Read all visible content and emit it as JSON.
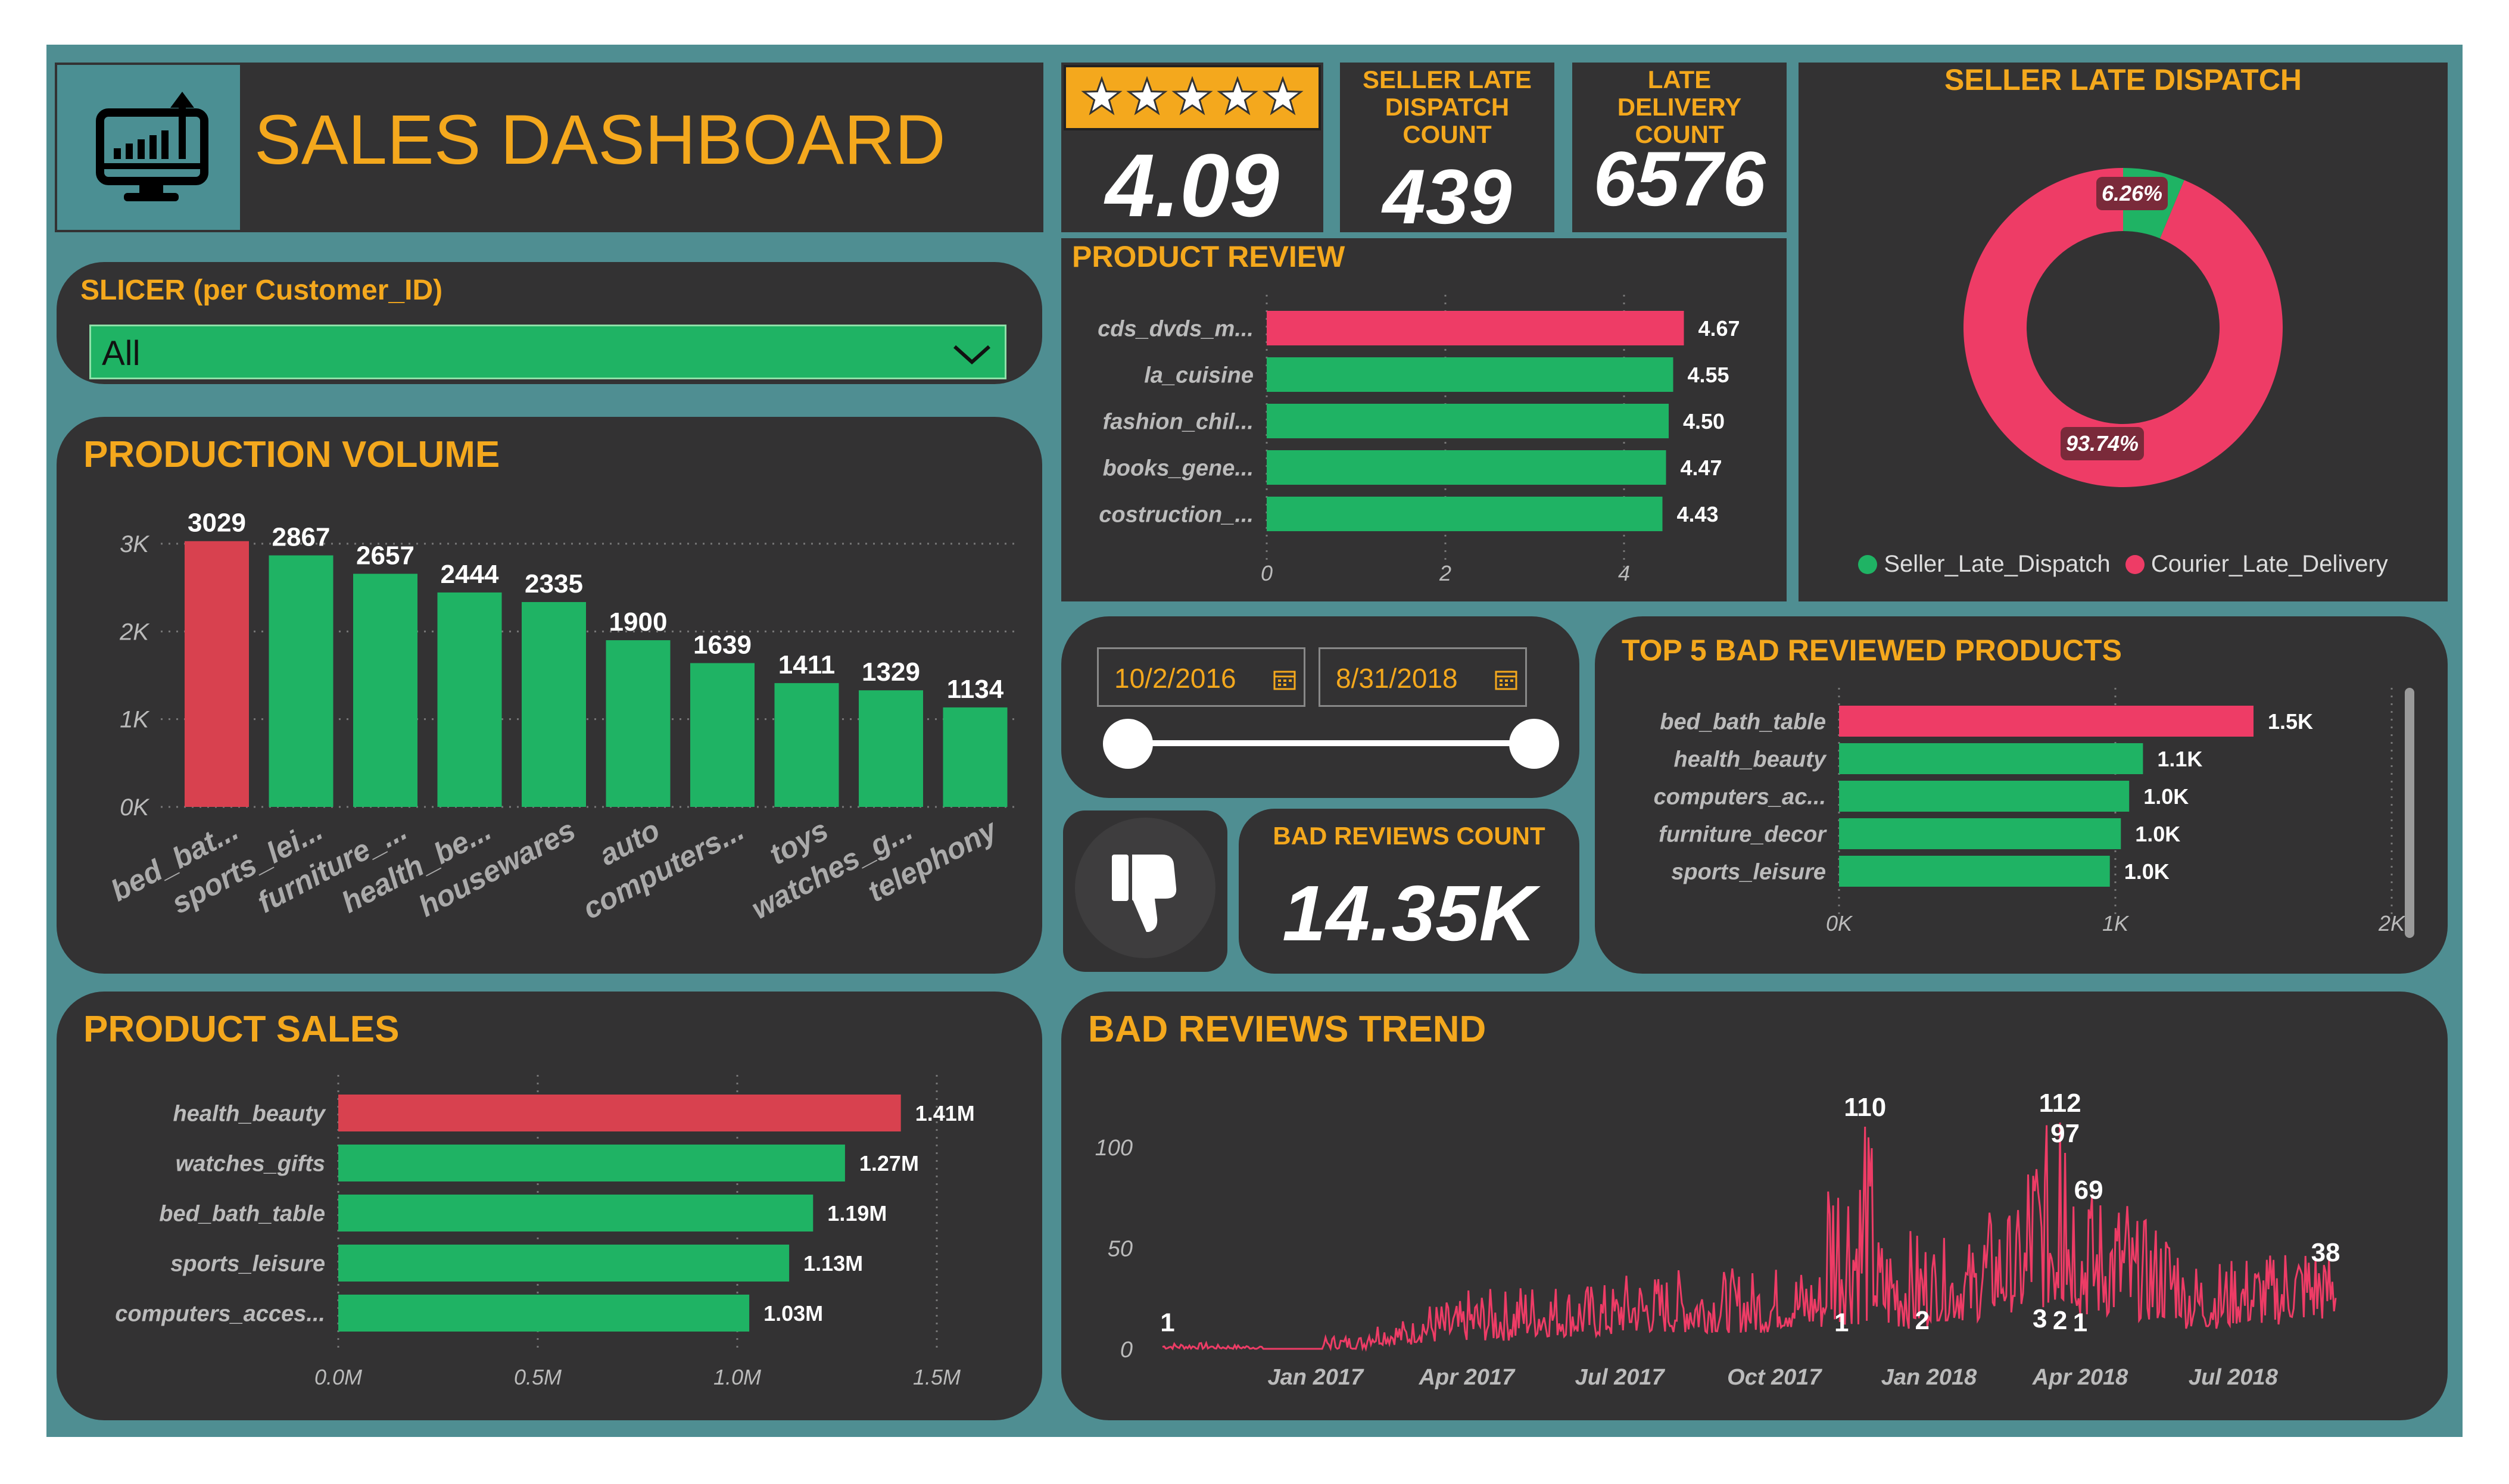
{
  "header": {
    "title": "SALES DASHBOARD",
    "icon": "monitor-chart-icon"
  },
  "kpis": {
    "rating": {
      "value": "4.09",
      "stars": 5
    },
    "seller_late_dispatch_count": {
      "label": "SELLER LATE DISPATCH COUNT",
      "value": "439"
    },
    "late_delivery_count": {
      "label": "LATE DELIVERY COUNT",
      "value": "6576"
    },
    "bad_reviews_count": {
      "label": "BAD REVIEWS COUNT",
      "value": "14.35K"
    }
  },
  "slicer": {
    "title": "SLICER (per Customer_ID)",
    "selected": "All"
  },
  "date_range": {
    "start": "10/2/2016",
    "end": "8/31/2018"
  },
  "colors": {
    "accent": "#f4a81d",
    "green": "#1fb364",
    "red": "#d8414f",
    "pink": "#ee3c66",
    "panel": "#333233",
    "frame": "#4f8e92"
  },
  "chart_data": [
    {
      "id": "production_volume",
      "type": "bar",
      "title": "PRODUCTION VOLUME",
      "categories": [
        "bed_bat...",
        "sports_lei...",
        "furniture_...",
        "health_be...",
        "housewares",
        "auto",
        "computers...",
        "toys",
        "watches_g...",
        "telephony"
      ],
      "values": [
        3029,
        2867,
        2657,
        2444,
        2335,
        1900,
        1639,
        1411,
        1329,
        1134
      ],
      "yticks": [
        "0K",
        "1K",
        "2K",
        "3K"
      ],
      "ylim": [
        0,
        3000
      ],
      "highlight_index": 0
    },
    {
      "id": "product_review",
      "type": "bar",
      "orientation": "horizontal",
      "title": "PRODUCT REVIEW",
      "categories": [
        "cds_dvds_m...",
        "la_cuisine",
        "fashion_chil...",
        "books_gene...",
        "costruction_..."
      ],
      "values": [
        4.67,
        4.55,
        4.5,
        4.47,
        4.43
      ],
      "labels": [
        "4.67",
        "4.55",
        "4.50",
        "4.47",
        "4.43"
      ],
      "xticks": [
        "0",
        "2",
        "4"
      ],
      "xlim": [
        0,
        5.4
      ],
      "highlight_index": 0
    },
    {
      "id": "seller_late_dispatch",
      "type": "pie",
      "title": "SELLER LATE DISPATCH",
      "slices": [
        {
          "name": "Seller_Late_Dispatch",
          "value": 6.26,
          "label": "6.26%",
          "color": "#1fb364"
        },
        {
          "name": "Courier_Late_Delivery",
          "value": 93.74,
          "label": "93.74%",
          "color": "#ee3c66"
        }
      ]
    },
    {
      "id": "top5_bad_reviewed",
      "type": "bar",
      "orientation": "horizontal",
      "title": "TOP 5 BAD REVIEWED PRODUCTS",
      "categories": [
        "bed_bath_table",
        "health_beauty",
        "computers_ac...",
        "furniture_decor",
        "sports_leisure"
      ],
      "values": [
        1.5,
        1.1,
        1.05,
        1.02,
        0.98
      ],
      "labels": [
        "1.5K",
        "1.1K",
        "1.0K",
        "1.0K",
        "1.0K"
      ],
      "xticks": [
        "0K",
        "1K",
        "2K"
      ],
      "xlim": [
        0,
        2
      ],
      "unit": "K",
      "highlight_index": 0
    },
    {
      "id": "product_sales",
      "type": "bar",
      "orientation": "horizontal",
      "title": "PRODUCT SALES",
      "categories": [
        "health_beauty",
        "watches_gifts",
        "bed_bath_table",
        "sports_leisure",
        "computers_acces..."
      ],
      "values": [
        1.41,
        1.27,
        1.19,
        1.13,
        1.03
      ],
      "labels": [
        "1.41M",
        "1.27M",
        "1.19M",
        "1.13M",
        "1.03M"
      ],
      "xticks": [
        "0.0M",
        "0.5M",
        "1.0M",
        "1.5M"
      ],
      "xlim": [
        0,
        1.5
      ],
      "unit": "M",
      "highlight_index": 0
    },
    {
      "id": "bad_reviews_trend",
      "type": "line",
      "title": "BAD REVIEWS TREND",
      "x_start": "2016-10-02",
      "x_end": "2018-08-31",
      "xticks": [
        "Jan 2017",
        "Apr 2017",
        "Jul 2017",
        "Oct 2017",
        "Jan 2018",
        "Apr 2018",
        "Jul 2018"
      ],
      "yticks": [
        "0",
        "50",
        "100"
      ],
      "ylim": [
        0,
        115
      ],
      "annotations": [
        {
          "label": "1",
          "date": "2016-10-05",
          "value": 1
        },
        {
          "label": "110",
          "date": "2017-11-24",
          "value": 110
        },
        {
          "label": "1",
          "date": "2017-11-10",
          "value": 1
        },
        {
          "label": "2",
          "date": "2017-12-28",
          "value": 2
        },
        {
          "label": "112",
          "date": "2018-03-20",
          "value": 112
        },
        {
          "label": "97",
          "date": "2018-03-23",
          "value": 97
        },
        {
          "label": "69",
          "date": "2018-04-06",
          "value": 69
        },
        {
          "label": "3",
          "date": "2018-03-08",
          "value": 3
        },
        {
          "label": "2",
          "date": "2018-03-20",
          "value": 2
        },
        {
          "label": "1",
          "date": "2018-04-01",
          "value": 1
        },
        {
          "label": "38",
          "date": "2018-08-25",
          "value": 38
        }
      ],
      "monthly_profile": [
        {
          "month": "2016-10",
          "low": 0,
          "high": 3
        },
        {
          "month": "2016-11",
          "low": 0,
          "high": 2
        },
        {
          "month": "2016-12",
          "low": 0,
          "high": 1
        },
        {
          "month": "2017-01",
          "low": 0,
          "high": 7
        },
        {
          "month": "2017-02",
          "low": 2,
          "high": 15
        },
        {
          "month": "2017-03",
          "low": 3,
          "high": 24
        },
        {
          "month": "2017-04",
          "low": 4,
          "high": 30
        },
        {
          "month": "2017-05",
          "low": 6,
          "high": 34
        },
        {
          "month": "2017-06",
          "low": 6,
          "high": 33
        },
        {
          "month": "2017-07",
          "low": 8,
          "high": 38
        },
        {
          "month": "2017-08",
          "low": 8,
          "high": 40
        },
        {
          "month": "2017-09",
          "low": 8,
          "high": 40
        },
        {
          "month": "2017-10",
          "low": 10,
          "high": 42
        },
        {
          "month": "2017-11",
          "low": 12,
          "high": 110
        },
        {
          "month": "2017-12",
          "low": 10,
          "high": 60
        },
        {
          "month": "2018-01",
          "low": 14,
          "high": 55
        },
        {
          "month": "2018-02",
          "low": 18,
          "high": 70
        },
        {
          "month": "2018-03",
          "low": 20,
          "high": 112
        },
        {
          "month": "2018-04",
          "low": 16,
          "high": 80
        },
        {
          "month": "2018-05",
          "low": 14,
          "high": 65
        },
        {
          "month": "2018-06",
          "low": 10,
          "high": 45
        },
        {
          "month": "2018-07",
          "low": 12,
          "high": 48
        },
        {
          "month": "2018-08",
          "low": 14,
          "high": 55
        }
      ]
    }
  ]
}
